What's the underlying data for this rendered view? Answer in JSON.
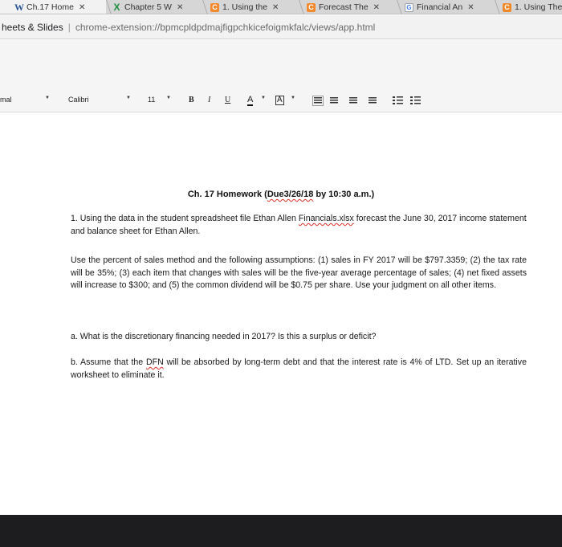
{
  "browser": {
    "tabs": [
      {
        "label": "Ch.17 Home",
        "icon": "word-icon",
        "active": true
      },
      {
        "label": "Chapter 5 W",
        "icon": "excel-icon",
        "active": false
      },
      {
        "label": "1. Using the",
        "icon": "chegg-icon",
        "active": false
      },
      {
        "label": "Forecast The",
        "icon": "chegg-icon",
        "active": false
      },
      {
        "label": "Financial An",
        "icon": "google-icon",
        "active": false
      },
      {
        "label": "1. Using The",
        "icon": "chegg-icon",
        "active": false
      }
    ],
    "address": {
      "site": "heets & Slides",
      "url": "chrome-extension://bpmcpldpdmajfigpchkicefoigmkfalc/views/app.html"
    }
  },
  "toolbar": {
    "style": "mal",
    "font": "Calibri",
    "size": "11",
    "bold": "B",
    "italic": "I",
    "underline": "U",
    "text_color": "A",
    "highlight": "A"
  },
  "document": {
    "title_prefix": "Ch. 17 Homework (",
    "title_due": "Due3/26/18",
    "title_suffix": " by 10:30 a.m.)",
    "q1_part1": "1.  Using the data in the student spreadsheet file Ethan Allen ",
    "q1_file": "Financials.xlsx",
    "q1_part2": " forecast the June 30, 2017 income statement and balance sheet for Ethan Allen.",
    "assumptions": "Use the percent of sales method and the following assumptions: (1) sales in FY 2017 will be $797.3359; (2) the tax rate will be 35%; (3) each item that changes with sales will be the five-year average percentage of sales; (4) net fixed assets will increase to $300; and (5) the common dividend will be $0.75  per share. Use your judgment on all other items.",
    "qa": "a. What is the discretionary financing needed in 2017? Is this a surplus or deficit?",
    "qb_part1": "b. Assume that the ",
    "qb_dfn": "DFN",
    "qb_part2": " will be absorbed by long-term debt and that the interest rate is 4% of LTD. Set up an iterative worksheet to eliminate it."
  },
  "colors": {
    "spellcheck": "#d93025",
    "bottom_band": "#1d1d1f",
    "tab_active": "#f2f2f2",
    "tab_inactive": "#d6d6d6"
  }
}
